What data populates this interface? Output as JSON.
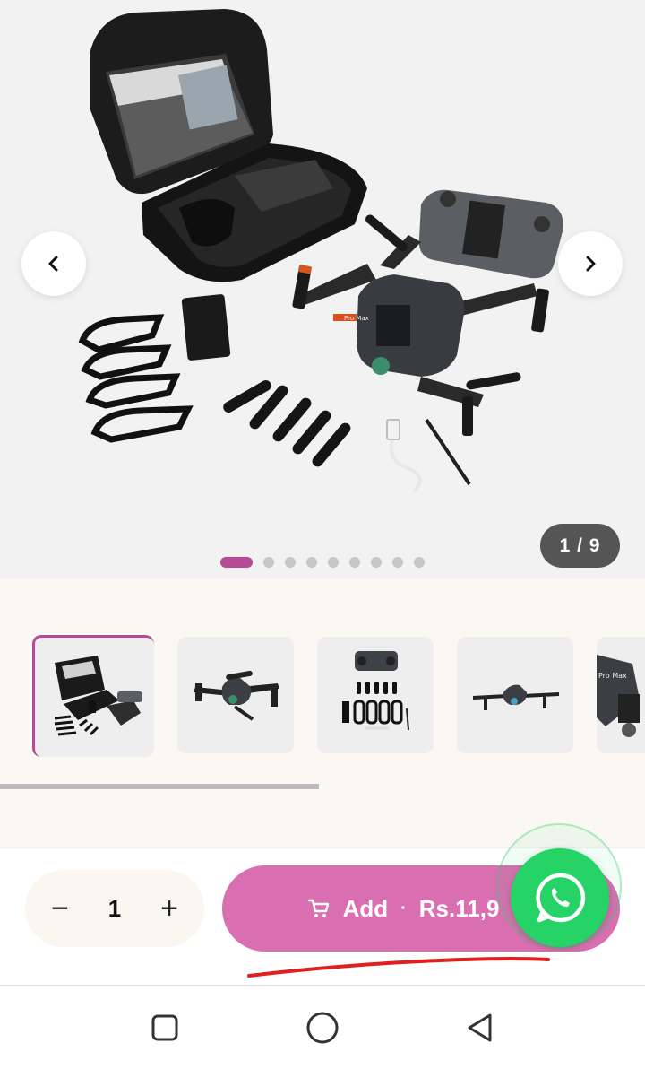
{
  "gallery": {
    "counter": "1 / 9",
    "total_images": 9,
    "current_index": 1,
    "prev_icon": "chevron-left-icon",
    "next_icon": "chevron-right-icon",
    "drone_label": "Pro Max"
  },
  "thumbnails": [
    {
      "name": "thumb-kit",
      "active": true
    },
    {
      "name": "thumb-drone-front",
      "active": false
    },
    {
      "name": "thumb-accessories",
      "active": false
    },
    {
      "name": "thumb-drone-side",
      "active": false
    },
    {
      "name": "thumb-drone-closeup",
      "active": false
    }
  ],
  "purchase": {
    "qty_minus": "−",
    "qty_value": "1",
    "qty_plus": "+",
    "add_label": "Add",
    "separator": "·",
    "price": "Rs.11,9",
    "cart_icon": "cart-icon",
    "whatsapp_icon": "whatsapp-icon"
  },
  "system_nav": {
    "recents": "square-icon",
    "home": "circle-icon",
    "back": "triangle-back-icon"
  },
  "colors": {
    "accent": "#d96fb1",
    "dot_active": "#b74a96",
    "whatsapp": "#25d366",
    "underline": "#e0201e"
  }
}
